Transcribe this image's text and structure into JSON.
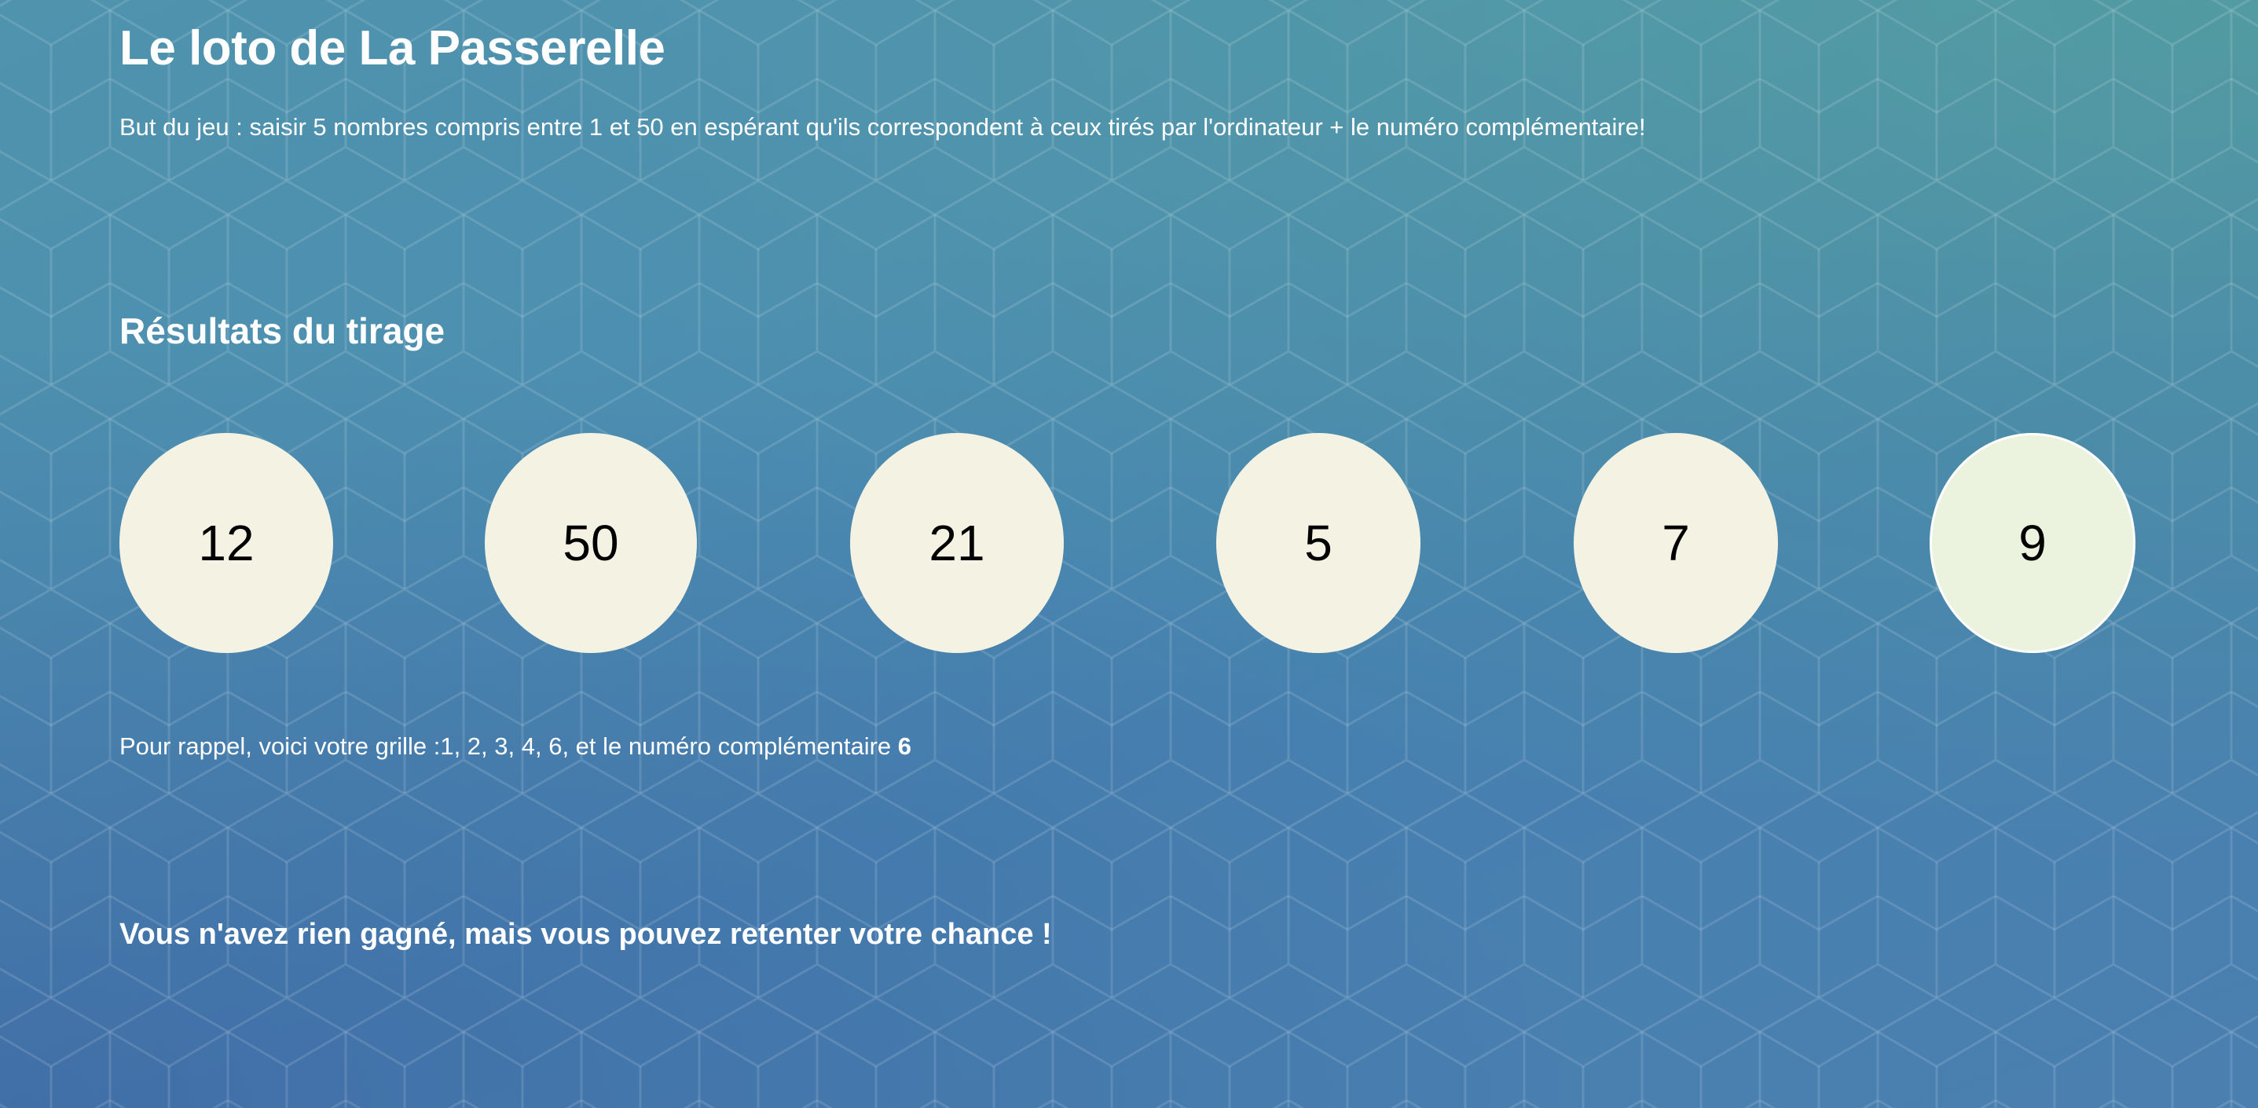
{
  "page": {
    "title": "Le loto de La Passerelle",
    "rules": "But du jeu : saisir 5 nombres compris entre 1 et 50 en espérant qu'ils correspondent à ceux tirés par l'ordinateur + le numéro complémentaire!"
  },
  "results": {
    "heading": "Résultats du tirage",
    "balls": [
      "12",
      "50",
      "21",
      "5",
      "7"
    ],
    "bonus_ball": "9"
  },
  "reminder": {
    "text": "Pour rappel, voici votre grille :1, 2, 3, 4, 6, et le numéro complémentaire ",
    "bonus": "6"
  },
  "outcome": {
    "message": "Vous n'avez rien gagné, mais vous pouvez retenter votre chance !"
  },
  "colors": {
    "ball": "#f4f3e3",
    "bonus_ball": "#ebf3df",
    "text": "#ffffff"
  }
}
